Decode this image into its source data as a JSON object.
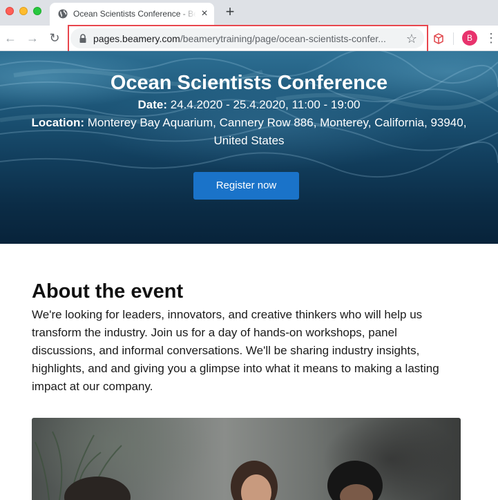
{
  "browser": {
    "tab_title": "Ocean Scientists Conference - Beamery",
    "url_host": "pages.beamery.com",
    "url_path": "/beamerytraining/page/ocean-scientists-confer...",
    "avatar_initial": "B",
    "icons": {
      "back": "arrow-left-icon",
      "forward": "arrow-right-icon",
      "reload": "reload-icon",
      "lock": "lock-icon",
      "bookmark": "star-icon",
      "extension": "cube-extension-icon",
      "menu": "kebab-menu-icon",
      "favicon": "globe-icon"
    },
    "colors": {
      "highlight": "#e8454d",
      "avatar": "#e8336d"
    }
  },
  "hero": {
    "title": "Ocean Scientists Conference",
    "date_label": "Date:",
    "date_value": " 24.4.2020 - 25.4.2020, 11:00 - 19:00",
    "location_label": "Location:",
    "location_value": " Monterey Bay Aquarium, Cannery Row 886, Monterey, California, 93940, United States",
    "register_label": "Register now",
    "button_color": "#1a73c9"
  },
  "about": {
    "title": "About the event",
    "text": "We're looking for leaders, innovators, and creative thinkers who will help us transform the industry. Join us for a day of hands-on workshops, panel discussions, and informal conversations. We'll be sharing industry insights, highlights, and and giving you a glimpse into what it means to making a lasting impact at our company."
  }
}
